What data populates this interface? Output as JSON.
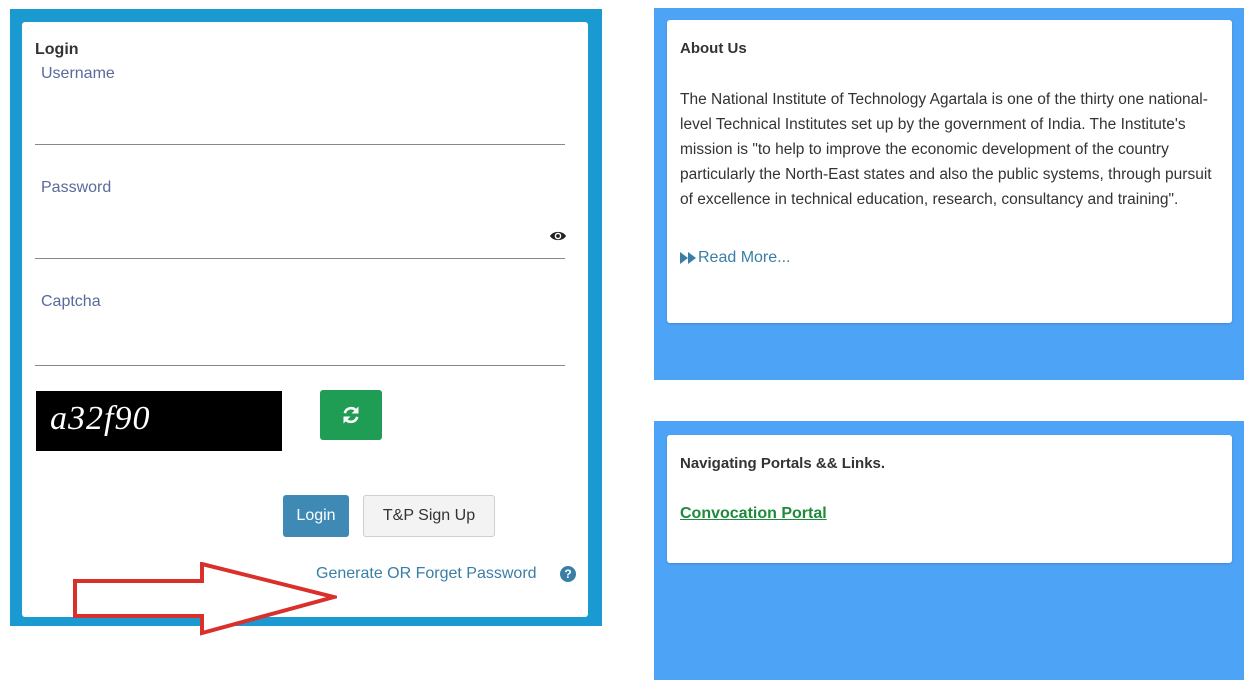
{
  "login": {
    "title": "Login",
    "username_label": "Username",
    "username_value": "",
    "password_label": "Password",
    "password_value": "",
    "captcha_label": "Captcha",
    "captcha_value": "",
    "captcha_code": "a32f90",
    "login_button": "Login",
    "signup_button": "T&P Sign Up",
    "forget_link": "Generate OR Forget Password",
    "icons": [
      "eye-icon",
      "refresh-icon",
      "question-circle-icon"
    ]
  },
  "about": {
    "title": "About Us",
    "text": "The National Institute of Technology Agartala is one of the thirty one national-level Technical Institutes set up by the government of India. The Institute's mission is \"to help to improve the economic development of the country particularly the North-East states and also the public systems, through pursuit of excellence in technical education, research, consultancy and training\".",
    "read_more": "Read More..."
  },
  "portals": {
    "title": "Navigating Portals && Links.",
    "convocation_link": "Convocation Portal"
  },
  "colors": {
    "login_frame": "#1a9ad0",
    "right_panels": "#4da3f5",
    "login_button": "#3e8ab4",
    "refresh_button": "#1f9d55",
    "link": "#3a7ea6",
    "convocation_link": "#1f8a3c",
    "annotation_arrow": "#d9302c"
  }
}
